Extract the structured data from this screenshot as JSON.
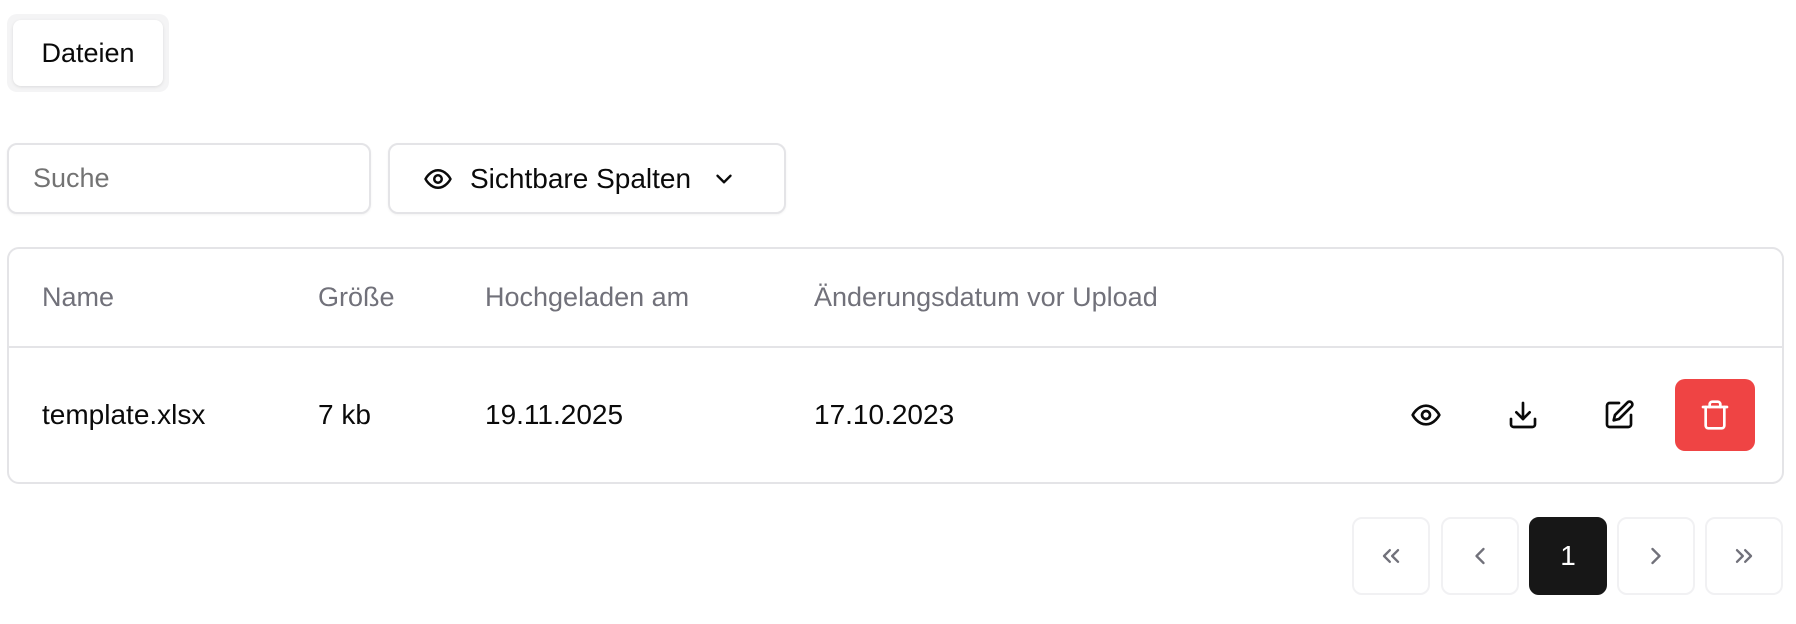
{
  "tabs": [
    {
      "label": "Dateien",
      "active": true
    }
  ],
  "toolbar": {
    "search_placeholder": "Suche",
    "search_value": "",
    "columns_button_label": "Sichtbare Spalten"
  },
  "table": {
    "headers": [
      "Name",
      "Größe",
      "Hochgeladen am",
      "Änderungsdatum vor Upload"
    ],
    "rows": [
      {
        "name": "template.xlsx",
        "size": "7 kb",
        "uploaded": "19.11.2025",
        "modified": "17.10.2023",
        "actions": [
          "eye-icon",
          "download-icon",
          "edit-icon",
          "trash-icon"
        ]
      }
    ]
  },
  "pagination": {
    "current_page": "1",
    "controls": [
      "chevrons-left-icon",
      "chevron-left-icon",
      "chevron-right-icon",
      "chevrons-right-icon"
    ]
  },
  "colors": {
    "danger": "#ef4444",
    "active_page": "#171717",
    "border": "#e4e4e7",
    "muted_text": "#71717a"
  }
}
